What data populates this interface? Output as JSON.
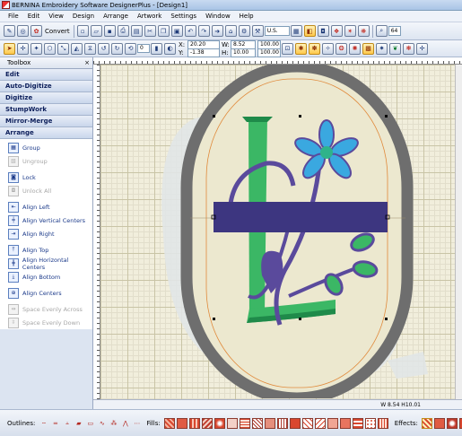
{
  "window": {
    "title": "BERNINA Embroidery Software DesignerPlus - [Design1]"
  },
  "menu": [
    "File",
    "Edit",
    "View",
    "Design",
    "Arrange",
    "Artwork",
    "Settings",
    "Window",
    "Help"
  ],
  "toolbar1": {
    "convert_label": "Convert",
    "units_value": "U.S.",
    "zoom_value": "64"
  },
  "toolbar2": {
    "rotate_value": "0",
    "x_label": "X:",
    "x_value": "20.20",
    "y_label": "Y:",
    "y_value": "-1.38",
    "w_label": "W:",
    "w_value": "8.52",
    "h_label": "H:",
    "h_value": "10.00",
    "w_pct": "100.00",
    "h_pct": "100.00"
  },
  "panel": {
    "title": "Toolbox",
    "categories": [
      "Edit",
      "Auto-Digitize",
      "Digitize",
      "StumpWork",
      "Mirror-Merge",
      "Arrange"
    ],
    "items": [
      {
        "label": "Group",
        "icon": "group-icon",
        "enabled": true
      },
      {
        "label": "Ungroup",
        "icon": "ungroup-icon",
        "enabled": false
      },
      {
        "label": "Lock",
        "icon": "lock-icon",
        "enabled": true
      },
      {
        "label": "Unlock All",
        "icon": "unlock-icon",
        "enabled": false
      },
      {
        "label": "Align Left",
        "icon": "align-left-icon",
        "enabled": true
      },
      {
        "label": "Align Vertical Centers",
        "icon": "align-vertical-centers-icon",
        "enabled": true
      },
      {
        "label": "Align Right",
        "icon": "align-right-icon",
        "enabled": true
      },
      {
        "label": "Align Top",
        "icon": "align-top-icon",
        "enabled": true
      },
      {
        "label": "Align Horizontal Centers",
        "icon": "align-horizontal-centers-icon",
        "enabled": true
      },
      {
        "label": "Align Bottom",
        "icon": "align-bottom-icon",
        "enabled": true
      },
      {
        "label": "Align Centers",
        "icon": "align-centers-icon",
        "enabled": true
      },
      {
        "label": "Space Evenly Across",
        "icon": "space-across-icon",
        "enabled": false
      },
      {
        "label": "Space Evenly Down",
        "icon": "space-down-icon",
        "enabled": false
      }
    ]
  },
  "status": {
    "text": "W 8.54 H10.01"
  },
  "bottombar": {
    "outlines_label": "Outlines:",
    "fills_label": "Fills:",
    "effects_label": "Effects:"
  },
  "colors": {
    "hoop": "#6e6e6e",
    "letter_green": "#3bb765",
    "letter_dark_green": "#1f8a4a",
    "purple": "#5a4a9c",
    "bar_purple": "#3d3680",
    "flower_blue": "#3aa8e0",
    "flower_center": "#2fb38a",
    "guide_orange": "#e08a3c"
  }
}
